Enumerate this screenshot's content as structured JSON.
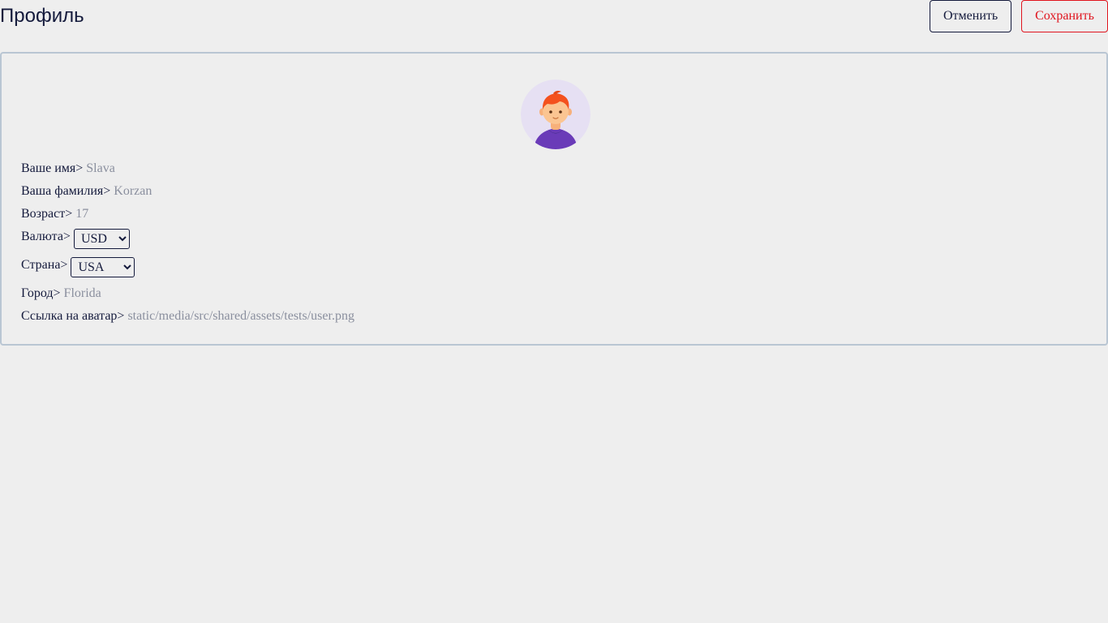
{
  "header": {
    "title": "Профиль",
    "cancel_label": "Отменить",
    "save_label": "Сохранить"
  },
  "profile": {
    "avatar_icon": "user-avatar-icon",
    "fields": {
      "first_name": {
        "label": "Ваше имя>",
        "value": "Slava"
      },
      "last_name": {
        "label": "Ваша фамилия>",
        "value": "Korzan"
      },
      "age": {
        "label": "Возраст>",
        "value": "17"
      },
      "currency": {
        "label": "Валюта>",
        "selected": "USD"
      },
      "country": {
        "label": "Страна>",
        "selected": "USA"
      },
      "city": {
        "label": "Город>",
        "value": "Florida"
      },
      "avatar_link": {
        "label": "Ссылка на аватар>",
        "value": "static/media/src/shared/assets/tests/user.png"
      }
    }
  },
  "colors": {
    "background": "#eeeeee",
    "primary_text": "#141a3c",
    "secondary_text": "#8a8f9e",
    "danger": "#e0141e",
    "card_border": "#b9c6d3"
  }
}
